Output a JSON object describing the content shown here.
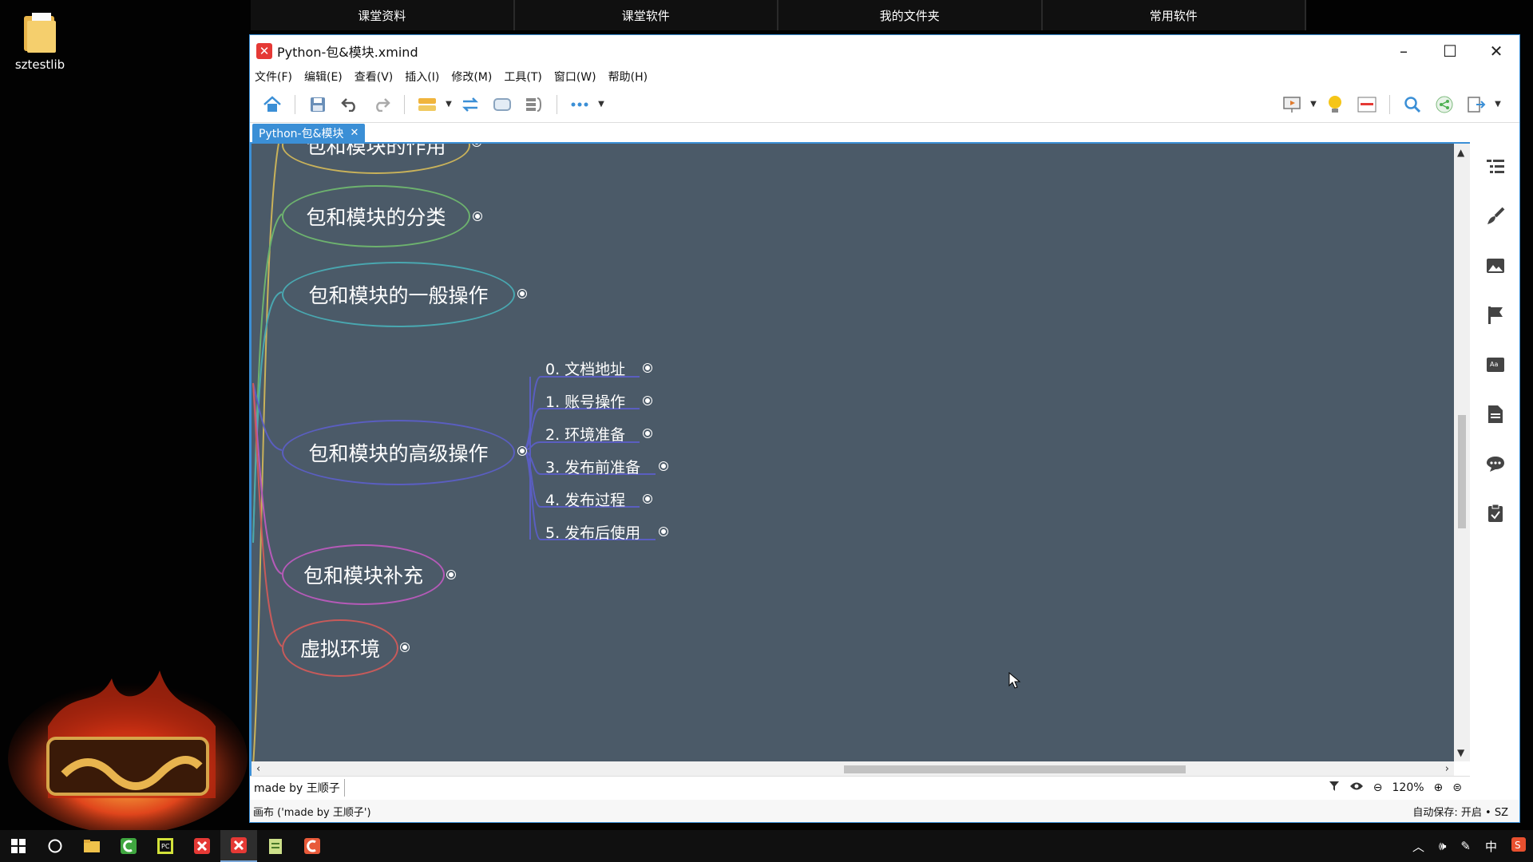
{
  "desktop": {
    "icon_label": "sztestlib"
  },
  "topbar": {
    "items": [
      "课堂资料",
      "课堂软件",
      "我的文件夹",
      "常用软件"
    ]
  },
  "window": {
    "title": "Python-包&模块.xmind",
    "controls": {
      "minimize": "–",
      "maximize": "☐",
      "close": "✕"
    }
  },
  "menu": {
    "items": [
      "文件(F)",
      "编辑(E)",
      "查看(V)",
      "插入(I)",
      "修改(M)",
      "工具(T)",
      "窗口(W)",
      "帮助(H)"
    ]
  },
  "tab": {
    "label": "Python-包&模块",
    "close": "✕"
  },
  "mindmap": {
    "topics": [
      {
        "label": "包和模块的作用",
        "color": "#c9b25a"
      },
      {
        "label": "包和模块的分类",
        "color": "#6db26e"
      },
      {
        "label": "包和模块的一般操作",
        "color": "#49a7b0"
      },
      {
        "label": "包和模块的高级操作",
        "color": "#5a5ec0"
      },
      {
        "label": "包和模块补充",
        "color": "#b55ab8"
      },
      {
        "label": "虚拟环境",
        "color": "#c85a5a"
      }
    ],
    "subtopics": [
      "0. 文档地址",
      "1. 账号操作",
      "2. 环境准备",
      "3. 发布前准备",
      "4. 发布过程",
      "5. 发布后使用"
    ]
  },
  "sheet": {
    "tab_label": "made by 王顺子"
  },
  "zoom": {
    "level": "120%"
  },
  "status": {
    "left": "画布 ('made by 王顺子')",
    "right": "自动保存: 开启 • SZ"
  },
  "tray": {
    "ime": "中"
  },
  "colors": {
    "canvas_bg": "#4b5a68",
    "accent": "#3b8fd6"
  }
}
